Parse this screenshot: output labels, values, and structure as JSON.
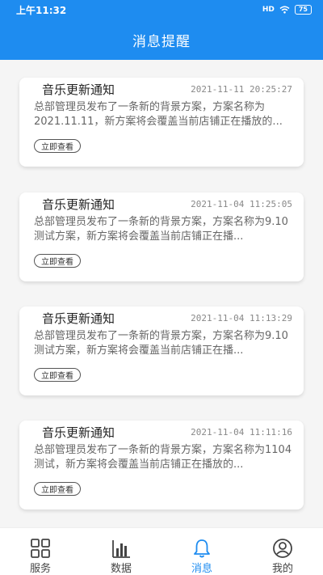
{
  "status": {
    "time": "上午11:32",
    "signal": "HD",
    "battery": "75"
  },
  "header": {
    "title": "消息提醒"
  },
  "messages": [
    {
      "title": "音乐更新通知",
      "time": "2021-11-11 20:25:27",
      "body": "总部管理员发布了一条新的背景方案，方案名称为2021.11.11，新方案将会覆盖当前店铺正在播放的...",
      "action": "立即查看"
    },
    {
      "title": "音乐更新通知",
      "time": "2021-11-04 11:25:05",
      "body": "总部管理员发布了一条新的背景方案，方案名称为9.10测试方案，新方案将会覆盖当前店铺正在播...",
      "action": "立即查看"
    },
    {
      "title": "音乐更新通知",
      "time": "2021-11-04 11:13:29",
      "body": "总部管理员发布了一条新的背景方案，方案名称为9.10测试方案，新方案将会覆盖当前店铺正在播...",
      "action": "立即查看"
    },
    {
      "title": "音乐更新通知",
      "time": "2021-11-04 11:11:16",
      "body": "总部管理员发布了一条新的背景方案，方案名称为1104测试，新方案将会覆盖当前店铺正在播放的...",
      "action": "立即查看"
    }
  ],
  "tabs": [
    {
      "label": "服务",
      "icon": "grid-icon",
      "active": false
    },
    {
      "label": "数据",
      "icon": "bar-chart-icon",
      "active": false
    },
    {
      "label": "消息",
      "icon": "bell-icon",
      "active": true
    },
    {
      "label": "我的",
      "icon": "user-icon",
      "active": false
    }
  ],
  "colors": {
    "accent": "#1e8cf0"
  }
}
